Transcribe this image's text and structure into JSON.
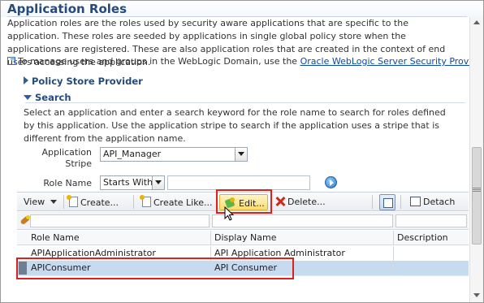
{
  "page": {
    "title": "Application Roles",
    "description": "Application roles are the roles used by security aware applications that are specific to the application. These roles are seeded by applications in single global policy store when the applications are registered. These are also application roles that are created in the context of end users accessing the application.",
    "manage_text": "To manage users and groups in the WebLogic Domain, use the",
    "manage_link": "Oracle WebLogic Server Security Provider",
    "manage_suffix": "."
  },
  "sections": {
    "policy_store": "Policy Store Provider",
    "search": "Search"
  },
  "search": {
    "description": "Select an application and enter a search keyword for the role name to search for roles defined by this application. Use the application stripe to search if the application uses a stripe that is different from the application name.",
    "stripe_label_line1": "Application",
    "stripe_label_line2": "Stripe",
    "stripe_value": "API_Manager",
    "role_name_label": "Role Name",
    "operator_value": "Starts With",
    "keyword_value": ""
  },
  "toolbar": {
    "view": "View",
    "create": "Create...",
    "create_like": "Create Like...",
    "edit": "Edit...",
    "delete": "Delete...",
    "detach": "Detach"
  },
  "table": {
    "columns": [
      "Role Name",
      "Display Name",
      "Description"
    ],
    "rows": [
      {
        "role_name": "APIApplicationAdministrator",
        "display_name": "API Application Administrator",
        "description": ""
      },
      {
        "role_name": "APIConsumer",
        "display_name": "API Consumer",
        "description": ""
      }
    ]
  },
  "colors": {
    "title": "#254a7c",
    "link": "#0a4aa8",
    "selected_row": "#c6daf0",
    "highlight_box": "#e0201a"
  },
  "icons": [
    "external-link-icon",
    "create-icon",
    "create-like-icon",
    "edit-icon",
    "delete-icon",
    "freeze-icon",
    "detach-icon",
    "filter-icon",
    "go-icon"
  ]
}
